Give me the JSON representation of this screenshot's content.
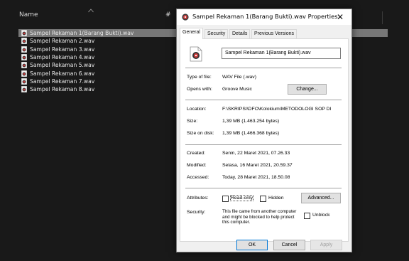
{
  "explorer": {
    "columns": {
      "name": "Name",
      "hash": "#"
    },
    "files": [
      {
        "name": "Sampel Rekaman 1(Barang Bukti).wav",
        "selected": true
      },
      {
        "name": "Sampel Rekaman 2.wav",
        "selected": false
      },
      {
        "name": "Sampel Rekaman 3.wav",
        "selected": false
      },
      {
        "name": "Sampel Rekaman 4.wav",
        "selected": false
      },
      {
        "name": "Sampel Rekaman 5.wav",
        "selected": false
      },
      {
        "name": "Sampel Rekaman 6.wav",
        "selected": false
      },
      {
        "name": "Sampel Rekaman 7.wav",
        "selected": false
      },
      {
        "name": "Sampel Rekaman 8.wav",
        "selected": false
      }
    ],
    "icon": "wav-file-icon"
  },
  "dialog": {
    "title": "Sampel Rekaman 1(Barang Bukti).wav Properties",
    "close_glyph": "✕",
    "tabs": [
      {
        "label": "General",
        "active": true
      },
      {
        "label": "Security",
        "active": false
      },
      {
        "label": "Details",
        "active": false
      },
      {
        "label": "Previous Versions",
        "active": false
      }
    ],
    "general": {
      "file_name": "Sampel Rekaman 1(Barang Bukti).wav",
      "type_label": "Type of file:",
      "type_value": "WAV File (.wav)",
      "opens_label": "Opens with:",
      "opens_value": "Groove Music",
      "change_button": "Change...",
      "location_label": "Location:",
      "location_value": "F:\\SKRIPSI\\DFO\\Kolokium\\METODOLOGI SOP DI",
      "size_label": "Size:",
      "size_value": "1,39 MB (1.463.254 bytes)",
      "size_disk_label": "Size on disk:",
      "size_disk_value": "1,39 MB (1.466.368 bytes)",
      "created_label": "Created:",
      "created_value": "Senin, 22 Maret 2021, 07.26.33",
      "modified_label": "Modified:",
      "modified_value": "Selasa, 16 Maret 2021, 20.59.37",
      "accessed_label": "Accessed:",
      "accessed_value": "Today, 28 Maret 2021, 18.50.08",
      "attributes_label": "Attributes:",
      "readonly_label": "Read-only",
      "hidden_label": "Hidden",
      "advanced_button": "Advanced...",
      "security_label": "Security:",
      "security_text": "This file came from another computer and might be blocked to help protect this computer.",
      "unblock_label": "Unblock"
    },
    "buttons": {
      "ok": "OK",
      "cancel": "Cancel",
      "apply": "Apply"
    }
  },
  "colors": {
    "explorer_bg": "#191919",
    "selection": "#777777",
    "dialog_bg": "#f0f0f0",
    "accent_border": "#0078d7"
  }
}
